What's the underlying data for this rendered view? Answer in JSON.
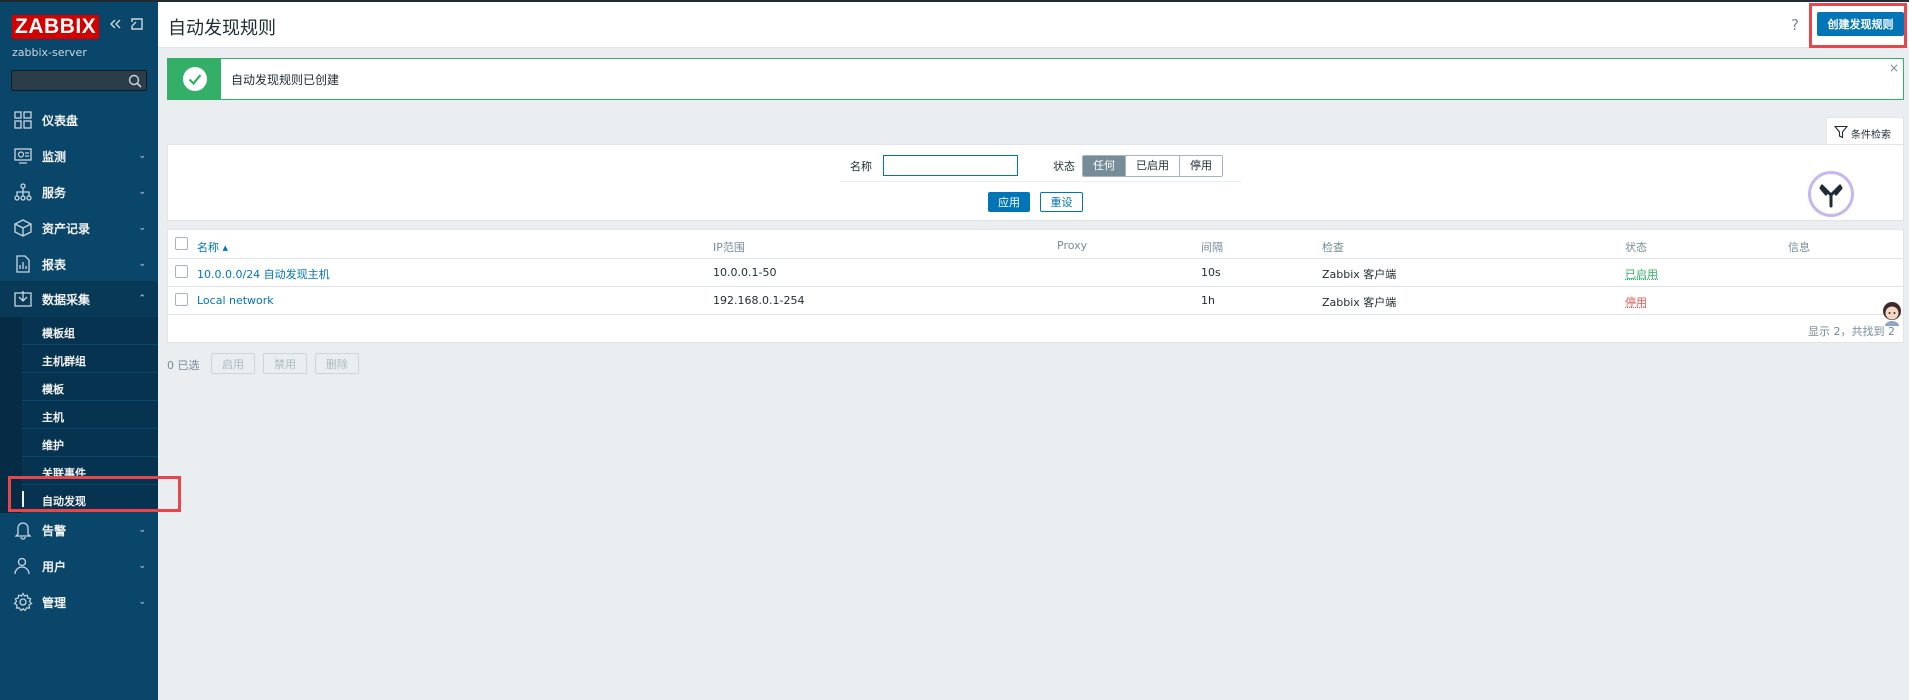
{
  "app": {
    "logo": "ZABBIX",
    "server_name": "zabbix-server",
    "search_placeholder": ""
  },
  "nav": {
    "items": [
      {
        "label": "仪表盘",
        "icon": "dashboard-icon",
        "has_children": false
      },
      {
        "label": "监测",
        "icon": "monitoring-icon",
        "has_children": true
      },
      {
        "label": "服务",
        "icon": "services-icon",
        "has_children": true
      },
      {
        "label": "资产记录",
        "icon": "inventory-icon",
        "has_children": true
      },
      {
        "label": "报表",
        "icon": "reports-icon",
        "has_children": true
      },
      {
        "label": "数据采集",
        "icon": "data-collection-icon",
        "has_children": true,
        "expanded": true
      },
      {
        "label": "告警",
        "icon": "bell-icon",
        "has_children": true
      },
      {
        "label": "用户",
        "icon": "users-icon",
        "has_children": true
      },
      {
        "label": "管理",
        "icon": "gear-icon",
        "has_children": true
      }
    ],
    "submenu": [
      {
        "label": "模板组"
      },
      {
        "label": "主机群组"
      },
      {
        "label": "模板"
      },
      {
        "label": "主机"
      },
      {
        "label": "维护"
      },
      {
        "label": "关联事件"
      },
      {
        "label": "自动发现",
        "selected": true
      }
    ],
    "expand_chevron": "⌃",
    "collapse_chevron": "⌄"
  },
  "header": {
    "title": "自动发现规则",
    "help": "?",
    "create_button": "创建发现规则"
  },
  "message": {
    "text": "自动发现规则已创建",
    "close": "×"
  },
  "filter": {
    "tab_label": "条件检索",
    "name_label": "名称",
    "name_value": "",
    "status_label": "状态",
    "status_options": [
      "任何",
      "已启用",
      "停用"
    ],
    "status_selected": "任何",
    "apply": "应用",
    "reset": "重设"
  },
  "table": {
    "columns": [
      "名称 ▴",
      "IP范围",
      "Proxy",
      "间隔",
      "检查",
      "状态",
      "信息"
    ],
    "rows": [
      {
        "name": "10.0.0.0/24 自动发现主机",
        "ip_range": "10.0.0.1-50",
        "proxy": "",
        "interval": "10s",
        "checks": "Zabbix 客户端",
        "status": "已启用",
        "info": ""
      },
      {
        "name": "Local network",
        "ip_range": "192.168.0.1-254",
        "proxy": "",
        "interval": "1h",
        "checks": "Zabbix 客户端",
        "status": "停用",
        "info": ""
      }
    ],
    "footer": "显示 2，共找到 2"
  },
  "actions": {
    "selected": "0 已选",
    "enable": "启用",
    "disable": "禁用",
    "delete": "删除"
  },
  "colors": {
    "sidebar": "#0a466a",
    "accent": "#0275b8",
    "success": "#34af67",
    "danger": "#e45959",
    "highlight": "#e8464b"
  }
}
